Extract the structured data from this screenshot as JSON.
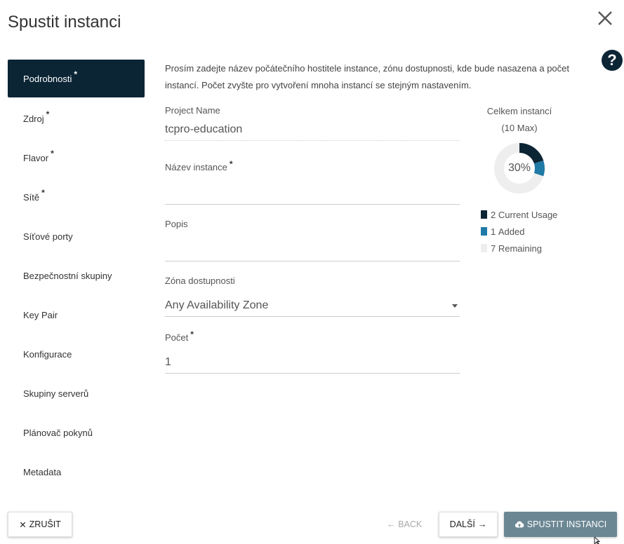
{
  "dialog": {
    "title": "Spustit instanci"
  },
  "sidebar": {
    "items": [
      {
        "label": "Podrobnosti",
        "required": true
      },
      {
        "label": "Zdroj",
        "required": true
      },
      {
        "label": "Flavor",
        "required": true
      },
      {
        "label": "Sítě",
        "required": true
      },
      {
        "label": "Síťové porty",
        "required": false
      },
      {
        "label": "Bezpečnostní skupiny",
        "required": false
      },
      {
        "label": "Key Pair",
        "required": false
      },
      {
        "label": "Konfigurace",
        "required": false
      },
      {
        "label": "Skupiny serverů",
        "required": false
      },
      {
        "label": "Plánovač pokynů",
        "required": false
      },
      {
        "label": "Metadata",
        "required": false
      }
    ],
    "star": "*"
  },
  "details": {
    "intro": "Prosím zadejte název počátečního hostitele instance, zónu dostupnosti, kde bude nasazena a počet instancí. Počet zvyšte pro vytvoření mnoha instancí se stejným nastavením.",
    "project_name_label": "Project Name",
    "project_name_value": "tcpro-education",
    "instance_name_label": "Název instance",
    "instance_name_value": "",
    "description_label": "Popis",
    "description_value": "",
    "zone_label": "Zóna dostupnosti",
    "zone_value": "Any Availability Zone",
    "count_label": "Počet",
    "count_value": "1"
  },
  "stats": {
    "title": "Celkem instancí",
    "max": "(10 Max)",
    "percent_label": "30%",
    "usage_fraction": 0.2,
    "added_fraction": 0.1,
    "legend": [
      {
        "count": "2",
        "label": "Current Usage",
        "color": "#0b2535"
      },
      {
        "count": "1",
        "label": "Added",
        "color": "#1f7aa6"
      },
      {
        "count": "7",
        "label": "Remaining",
        "color": "#eeeeee"
      }
    ]
  },
  "footer": {
    "cancel_label": "ZRUŠIT",
    "back_label": "BACK",
    "next_label": "DALŠÍ",
    "launch_label": "SPUSTIT INSTANCI"
  }
}
